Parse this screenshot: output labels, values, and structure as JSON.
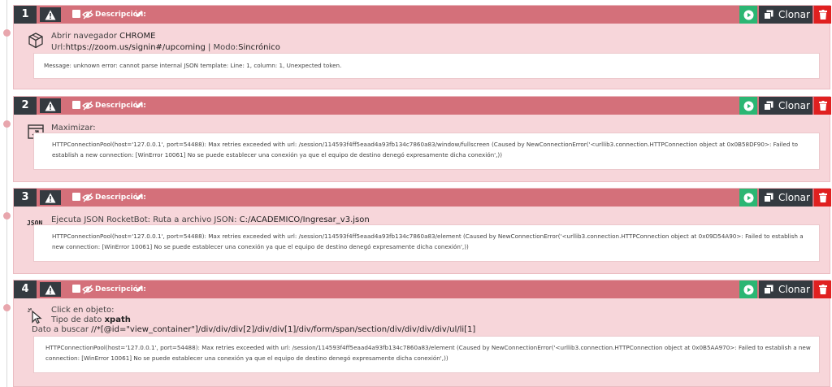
{
  "ui": {
    "description_label": "Descripción:",
    "clone_label": "Clonar",
    "colors": {
      "header": "#d4707a",
      "card": "#f7d6da",
      "dark": "#343a40",
      "play": "#2bb673",
      "trash": "#e02020"
    }
  },
  "commands": [
    {
      "number": "1",
      "icon": "cube-icon",
      "line1_label": "Abrir navegador ",
      "line1_value": "CHROME",
      "line2_label1": "Url:",
      "line2_value1": "https://zoom.us/signin#/upcoming",
      "line2_sep": " | Modo:",
      "line2_value2": "Sincrónico",
      "message": "Message: unknown error: cannot parse internal JSON template: Line: 1, column: 1, Unexpected token."
    },
    {
      "number": "2",
      "icon": "maximize-window-icon",
      "line1_label": "Maximizar:",
      "message": "HTTPConnectionPool(host='127.0.0.1', port=54488): Max retries exceeded with url: /session/114593f4ff5eaad4a93fb134c7860a83/window/fullscreen (Caused by NewConnectionError('<urllib3.connection.HTTPConnection object at 0x0B58DF90>: Failed to establish a new connection: [WinError 10061] No se puede establecer una conexión ya que el equipo de destino denegó expresamente dicha conexión',))"
    },
    {
      "number": "3",
      "icon": "json-icon",
      "icon_text": "JSON",
      "line1_label": "Ejecuta JSON RocketBot: Ruta a archivo JSON: ",
      "line1_value": "C:/ACADEMICO/Ingresar_v3.json",
      "message": "HTTPConnectionPool(host='127.0.0.1', port=54488): Max retries exceeded with url: /session/114593f4ff5eaad4a93fb134c7860a83/element (Caused by NewConnectionError('<urllib3.connection.HTTPConnection object at 0x09D54A90>: Failed to establish a new connection: [WinError 10061] No se puede establecer una conexión ya que el equipo de destino denegó expresamente dicha conexión',))"
    },
    {
      "number": "4",
      "icon": "cursor-click-icon",
      "line1_label": "Click en objeto:",
      "line2_label": "Tipo de dato ",
      "line2_value": "xpath",
      "line3_label": "Dato a buscar ",
      "line3_value": "//*[@id=\"view_container\"]/div/div/div[2]/div/div[1]/div/form/span/section/div/div/div/div/ul/li[1]",
      "message": "HTTPConnectionPool(host='127.0.0.1', port=54488): Max retries exceeded with url: /session/114593f4ff5eaad4a93fb134c7860a83/element (Caused by NewConnectionError('<urllib3.connection.HTTPConnection object at 0x0B5AA970>: Failed to establish a new connection: [WinError 10061] No se puede establecer una conexión ya que el equipo de destino denegó expresamente dicha conexión',))"
    }
  ]
}
